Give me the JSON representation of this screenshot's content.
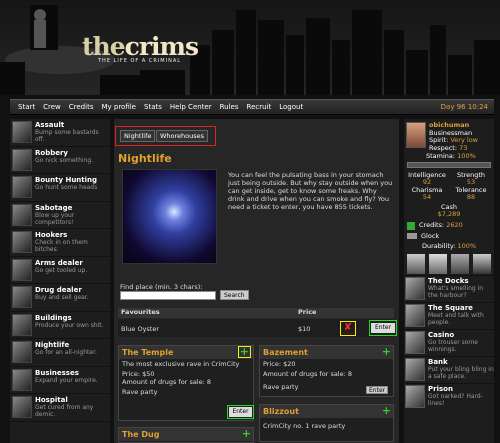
{
  "brand": {
    "logo_the": "the",
    "logo_crims": "crims",
    "tagline": "THE LIFE OF A CRIMINAL"
  },
  "nav": {
    "items": [
      "Start",
      "Crew",
      "Credits",
      "My profile",
      "Stats",
      "Help Center",
      "Rules",
      "Recruit",
      "Logout"
    ],
    "clock": "Day 96 10:24"
  },
  "sidebar": {
    "items": [
      {
        "title": "Assault",
        "desc": "Bump some bastards off."
      },
      {
        "title": "Robbery",
        "desc": "Go nick something."
      },
      {
        "title": "Bounty Hunting",
        "desc": "Go hunt some heads"
      },
      {
        "title": "Sabotage",
        "desc": "Blow up your competitors!"
      },
      {
        "title": "Hookers",
        "desc": "Check in on them bitches."
      },
      {
        "title": "Arms dealer",
        "desc": "Go get tooled up."
      },
      {
        "title": "Drug dealer",
        "desc": "Buy and sell gear."
      },
      {
        "title": "Buildings",
        "desc": "Produce your own shit."
      },
      {
        "title": "Nightlife",
        "desc": "Go for an all-nighter."
      },
      {
        "title": "Businesses",
        "desc": "Expand your empire."
      },
      {
        "title": "Hospital",
        "desc": "Get cured from any demic."
      }
    ]
  },
  "tabs": {
    "nightlife": "Nightlife",
    "whorehouses": "Whorehouses"
  },
  "main": {
    "title": "Nightlife",
    "description": "You can feel the pulsating bass in your stomach just being outside. But why stay outside when you can get inside, get to know some freaks. Why drink and drive when you can smoke and fly? You need a ticket to enter, you have 855 tickets.",
    "find_label": "Find place (min. 3 chars):",
    "search_button": "Search",
    "fav_header": "Favourites",
    "price_header": "Price",
    "fav_name": "Blue Oyster",
    "fav_price": "$10",
    "enter_label": "Enter",
    "delete_glyph": "✘"
  },
  "cards": [
    {
      "title": "The Temple",
      "lines": [
        "The most exclusive rave in CrimCity",
        "",
        "Price: $50",
        "Amount of drugs for sale: 8",
        "",
        "Rave party"
      ]
    },
    {
      "title": "Bazement",
      "lines": [
        "Price: $20",
        "Amount of drugs for sale: 8",
        "",
        "Rave party"
      ]
    },
    {
      "title": "Blizzout",
      "lines": [
        "CrimCity no. 1 rave party"
      ]
    },
    {
      "title": "The Dug",
      "lines": []
    }
  ],
  "profile": {
    "name": "obichuman",
    "rank": "Businessman",
    "spirit_label": "Spirit:",
    "spirit_value": "Very low",
    "respect_label": "Respect:",
    "respect_value": "73",
    "stamina_label": "Stamina:",
    "stamina_value": "100%",
    "intelligence_label": "Intelligence",
    "intelligence_value": "92",
    "strength_label": "Strength",
    "strength_value": "53",
    "charisma_label": "Charisma",
    "charisma_value": "54",
    "tolerance_label": "Tolerance",
    "tolerance_value": "88",
    "cash_label": "Cash",
    "cash_value": "$7,289",
    "credits_label": "Credits:",
    "credits_value": "2620",
    "weapon": "Glock",
    "durability_label": "Durability:",
    "durability_value": "100%"
  },
  "right_links": [
    {
      "title": "The Docks",
      "desc": "What's smelling in the harbour?"
    },
    {
      "title": "The Square",
      "desc": "Meet and talk with people."
    },
    {
      "title": "Casino",
      "desc": "Go trouser some winnings."
    },
    {
      "title": "Bank",
      "desc": "Put your bling bling in a safe place."
    },
    {
      "title": "Prison",
      "desc": "Got narked? Hard-lines!"
    }
  ],
  "colors": {
    "accent": "#e0a030",
    "highlight_red": "#dd2222",
    "highlight_green": "#22dd22",
    "highlight_yellow": "#eeee11"
  }
}
